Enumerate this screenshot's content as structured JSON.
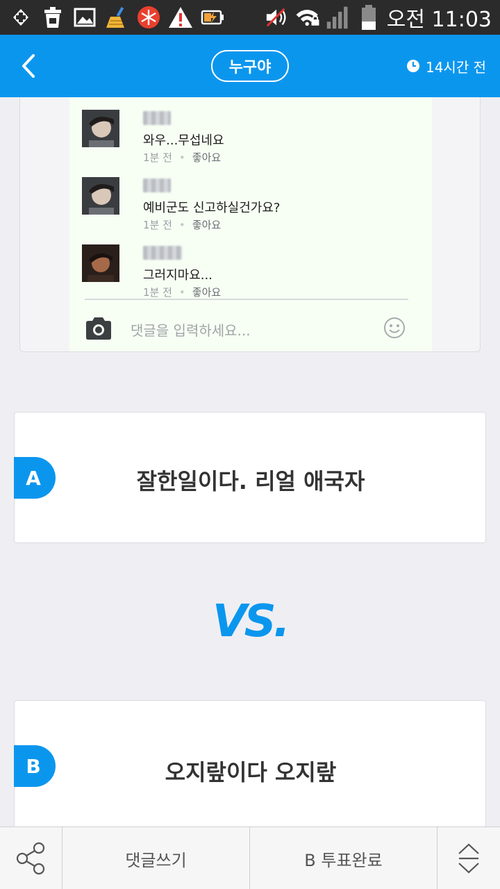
{
  "status_bar": {
    "left_icons": [
      "medical-cross-icon",
      "trash-can-icon",
      "image-icon",
      "broom-cleaner-icon",
      "snowflake-app-icon",
      "warning-icon",
      "battery-charging-icon"
    ],
    "right_icons": [
      "mute-icon",
      "wifi-lock-icon",
      "signal-icon",
      "battery-icon"
    ],
    "time": "오전 11:03"
  },
  "app_bar": {
    "title": "누구야",
    "time_ago": "14시간 전",
    "icons": [
      "back-chevron-icon",
      "clock-icon"
    ]
  },
  "post_screenshot": {
    "comments": [
      {
        "text": "와우...무섭네요",
        "time": "1분 전",
        "like": "좋아요"
      },
      {
        "text": "예비군도 신고하실건가요?",
        "time": "1분 전",
        "like": "좋아요"
      },
      {
        "text": "그러지마요...",
        "time": "1분 전",
        "like": "좋아요"
      }
    ],
    "input_placeholder": "댓글을 입력하세요..."
  },
  "options": {
    "a": {
      "badge": "A",
      "text": "잘한일이다. 리얼 애국자"
    },
    "vs": "VS.",
    "b": {
      "badge": "B",
      "text": "오지랖이다 오지랖"
    }
  },
  "bottom_bar": {
    "comment_label": "댓글쓰기",
    "vote_label": "B 투표완료"
  },
  "colors": {
    "accent": "#0b96ee",
    "status_bar_bg": "#2b2b2b",
    "page_bg": "#efeff3"
  }
}
